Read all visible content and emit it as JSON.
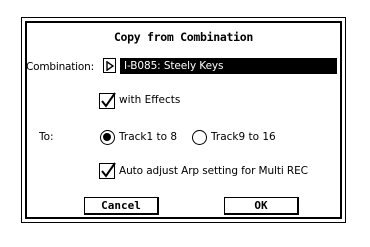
{
  "dialog": {
    "title": "Copy from Combination",
    "combination": {
      "label": "Combination:",
      "value": "I-B085: Steely Keys"
    },
    "with_effects": {
      "label": "with Effects",
      "checked": true
    },
    "to": {
      "label": "To:",
      "options": [
        {
          "label": "Track1 to 8",
          "selected": true
        },
        {
          "label": "Track9 to 16",
          "selected": false
        }
      ]
    },
    "auto_adjust": {
      "label": "Auto adjust Arp setting for Multi REC",
      "checked": true
    },
    "buttons": {
      "cancel": "Cancel",
      "ok": "OK"
    }
  },
  "icons": {
    "combination_selector": "right-triangle-icon",
    "check": "check-mark-icon"
  }
}
